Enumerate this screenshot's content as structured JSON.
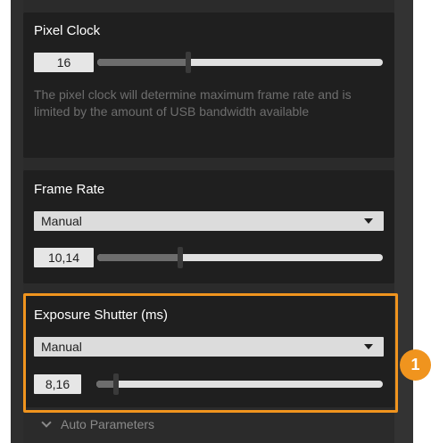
{
  "pixel_clock": {
    "title": "Pixel Clock",
    "value": "16",
    "slider_fraction": 0.32,
    "description": "The pixel clock will determine maximum frame rate and is limited by the amount of USB bandwidth available"
  },
  "frame_rate": {
    "title": "Frame Rate",
    "mode": "Manual",
    "value": "10,14",
    "slider_fraction": 0.29
  },
  "exposure": {
    "title": "Exposure Shutter (ms)",
    "mode": "Manual",
    "value": "8,16",
    "slider_fraction": 0.07,
    "auto_parameters_label": "Auto Parameters"
  },
  "callout": {
    "number": "1",
    "color": "#f0941e"
  },
  "icons": {
    "dropdown": "chevron-down-icon",
    "expander": "chevron-down-icon"
  }
}
